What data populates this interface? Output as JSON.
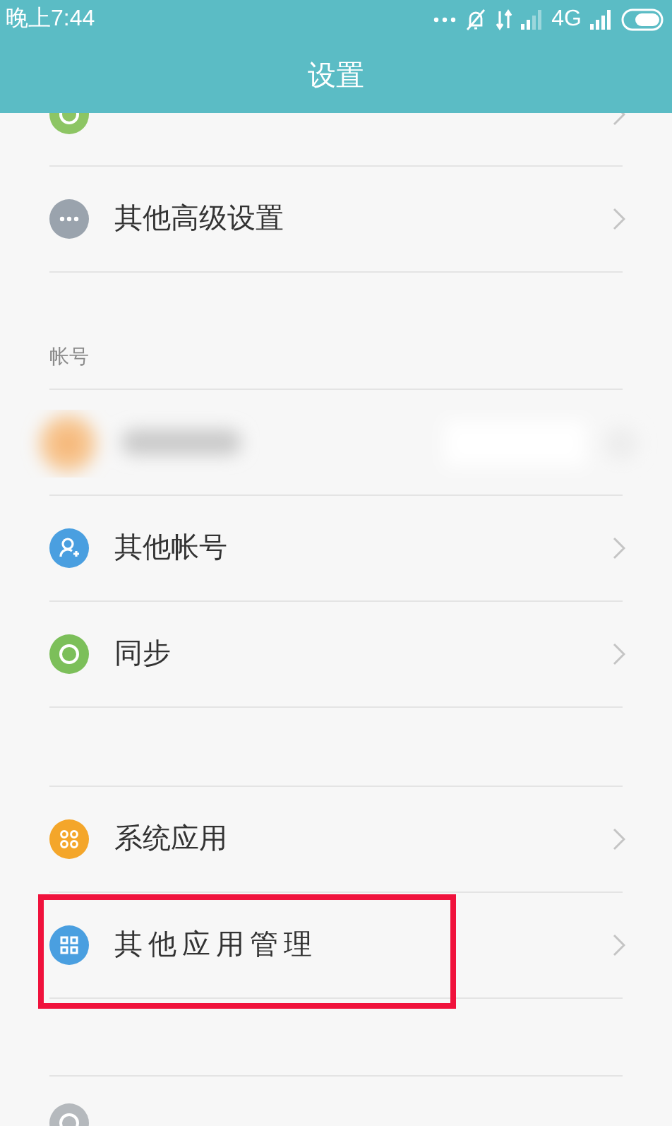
{
  "status_bar": {
    "time": "晚上7:44",
    "network": "4G"
  },
  "window": {
    "title": "设置"
  },
  "groups": [
    {
      "items": [
        {
          "label": "其他高级设置",
          "color": "#9aa3ad",
          "highlighted": false
        }
      ]
    },
    {
      "header": "帐号",
      "items": [
        {
          "kind": "blurred"
        },
        {
          "label": "其他帐号",
          "color": "#4a9fe0",
          "highlighted": false
        },
        {
          "label": "同步",
          "color": "#7cbf5a",
          "highlighted": false
        }
      ]
    },
    {
      "items": [
        {
          "label": "系统应用",
          "color": "#f4a62a",
          "highlighted": false
        },
        {
          "label": "其他应用管理",
          "color": "#4a9fe0",
          "highlighted": true
        }
      ]
    }
  ]
}
